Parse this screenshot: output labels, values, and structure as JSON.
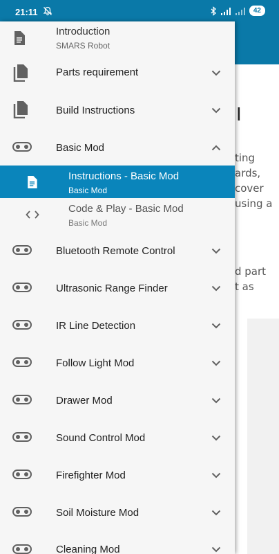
{
  "status_bar": {
    "time": "21:11",
    "battery": "42"
  },
  "background_page": {
    "lines": [
      "ting",
      "ards,",
      "cover",
      "using a",
      "d part",
      "t as"
    ]
  },
  "drawer": {
    "intro": {
      "title": "Introduction",
      "subtitle": "SMARS Robot"
    },
    "items": [
      {
        "label": "Parts requirement",
        "icon": "copy-icon",
        "expanded": false
      },
      {
        "label": "Build Instructions",
        "icon": "copy-icon",
        "expanded": false
      },
      {
        "label": "Basic Mod",
        "icon": "robot-icon",
        "expanded": true
      },
      {
        "label": "Bluetooth Remote Control",
        "icon": "robot-icon",
        "expanded": false
      },
      {
        "label": "Ultrasonic Range Finder",
        "icon": "robot-icon",
        "expanded": false
      },
      {
        "label": "IR Line Detection",
        "icon": "robot-icon",
        "expanded": false
      },
      {
        "label": "Follow Light Mod",
        "icon": "robot-icon",
        "expanded": false
      },
      {
        "label": "Drawer Mod",
        "icon": "robot-icon",
        "expanded": false
      },
      {
        "label": "Sound Control Mod",
        "icon": "robot-icon",
        "expanded": false
      },
      {
        "label": "Firefighter Mod",
        "icon": "robot-icon",
        "expanded": false
      },
      {
        "label": "Soil Moisture Mod",
        "icon": "robot-icon",
        "expanded": false
      },
      {
        "label": "Cleaning Mod",
        "icon": "robot-icon",
        "expanded": false
      }
    ],
    "sub_items": [
      {
        "label": "Instructions - Basic Mod",
        "subtitle": "Basic Mod",
        "icon": "document-icon",
        "active": true
      },
      {
        "label": "Code & Play - Basic Mod",
        "subtitle": "Basic Mod",
        "icon": "code-icon",
        "active": false
      }
    ]
  },
  "colors": {
    "primary": "#0a79a8",
    "active_item": "#0a85bb",
    "drawer_bg": "#f6f6f6"
  }
}
